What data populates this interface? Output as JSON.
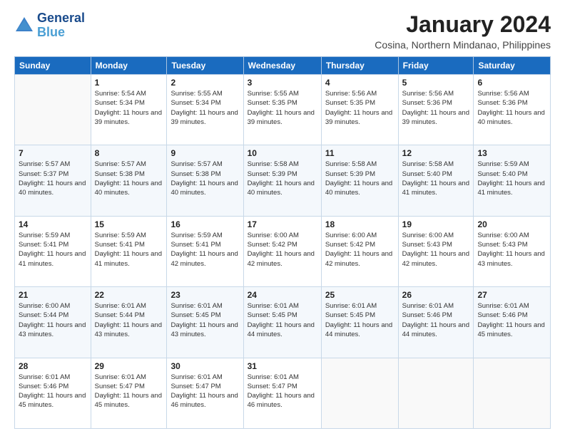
{
  "header": {
    "logo_line1": "General",
    "logo_line2": "Blue",
    "month": "January 2024",
    "location": "Cosina, Northern Mindanao, Philippines"
  },
  "weekdays": [
    "Sunday",
    "Monday",
    "Tuesday",
    "Wednesday",
    "Thursday",
    "Friday",
    "Saturday"
  ],
  "weeks": [
    [
      {
        "day": "",
        "sunrise": "",
        "sunset": "",
        "daylight": ""
      },
      {
        "day": "1",
        "sunrise": "Sunrise: 5:54 AM",
        "sunset": "Sunset: 5:34 PM",
        "daylight": "Daylight: 11 hours and 39 minutes."
      },
      {
        "day": "2",
        "sunrise": "Sunrise: 5:55 AM",
        "sunset": "Sunset: 5:34 PM",
        "daylight": "Daylight: 11 hours and 39 minutes."
      },
      {
        "day": "3",
        "sunrise": "Sunrise: 5:55 AM",
        "sunset": "Sunset: 5:35 PM",
        "daylight": "Daylight: 11 hours and 39 minutes."
      },
      {
        "day": "4",
        "sunrise": "Sunrise: 5:56 AM",
        "sunset": "Sunset: 5:35 PM",
        "daylight": "Daylight: 11 hours and 39 minutes."
      },
      {
        "day": "5",
        "sunrise": "Sunrise: 5:56 AM",
        "sunset": "Sunset: 5:36 PM",
        "daylight": "Daylight: 11 hours and 39 minutes."
      },
      {
        "day": "6",
        "sunrise": "Sunrise: 5:56 AM",
        "sunset": "Sunset: 5:36 PM",
        "daylight": "Daylight: 11 hours and 40 minutes."
      }
    ],
    [
      {
        "day": "7",
        "sunrise": "Sunrise: 5:57 AM",
        "sunset": "Sunset: 5:37 PM",
        "daylight": "Daylight: 11 hours and 40 minutes."
      },
      {
        "day": "8",
        "sunrise": "Sunrise: 5:57 AM",
        "sunset": "Sunset: 5:38 PM",
        "daylight": "Daylight: 11 hours and 40 minutes."
      },
      {
        "day": "9",
        "sunrise": "Sunrise: 5:57 AM",
        "sunset": "Sunset: 5:38 PM",
        "daylight": "Daylight: 11 hours and 40 minutes."
      },
      {
        "day": "10",
        "sunrise": "Sunrise: 5:58 AM",
        "sunset": "Sunset: 5:39 PM",
        "daylight": "Daylight: 11 hours and 40 minutes."
      },
      {
        "day": "11",
        "sunrise": "Sunrise: 5:58 AM",
        "sunset": "Sunset: 5:39 PM",
        "daylight": "Daylight: 11 hours and 40 minutes."
      },
      {
        "day": "12",
        "sunrise": "Sunrise: 5:58 AM",
        "sunset": "Sunset: 5:40 PM",
        "daylight": "Daylight: 11 hours and 41 minutes."
      },
      {
        "day": "13",
        "sunrise": "Sunrise: 5:59 AM",
        "sunset": "Sunset: 5:40 PM",
        "daylight": "Daylight: 11 hours and 41 minutes."
      }
    ],
    [
      {
        "day": "14",
        "sunrise": "Sunrise: 5:59 AM",
        "sunset": "Sunset: 5:41 PM",
        "daylight": "Daylight: 11 hours and 41 minutes."
      },
      {
        "day": "15",
        "sunrise": "Sunrise: 5:59 AM",
        "sunset": "Sunset: 5:41 PM",
        "daylight": "Daylight: 11 hours and 41 minutes."
      },
      {
        "day": "16",
        "sunrise": "Sunrise: 5:59 AM",
        "sunset": "Sunset: 5:41 PM",
        "daylight": "Daylight: 11 hours and 42 minutes."
      },
      {
        "day": "17",
        "sunrise": "Sunrise: 6:00 AM",
        "sunset": "Sunset: 5:42 PM",
        "daylight": "Daylight: 11 hours and 42 minutes."
      },
      {
        "day": "18",
        "sunrise": "Sunrise: 6:00 AM",
        "sunset": "Sunset: 5:42 PM",
        "daylight": "Daylight: 11 hours and 42 minutes."
      },
      {
        "day": "19",
        "sunrise": "Sunrise: 6:00 AM",
        "sunset": "Sunset: 5:43 PM",
        "daylight": "Daylight: 11 hours and 42 minutes."
      },
      {
        "day": "20",
        "sunrise": "Sunrise: 6:00 AM",
        "sunset": "Sunset: 5:43 PM",
        "daylight": "Daylight: 11 hours and 43 minutes."
      }
    ],
    [
      {
        "day": "21",
        "sunrise": "Sunrise: 6:00 AM",
        "sunset": "Sunset: 5:44 PM",
        "daylight": "Daylight: 11 hours and 43 minutes."
      },
      {
        "day": "22",
        "sunrise": "Sunrise: 6:01 AM",
        "sunset": "Sunset: 5:44 PM",
        "daylight": "Daylight: 11 hours and 43 minutes."
      },
      {
        "day": "23",
        "sunrise": "Sunrise: 6:01 AM",
        "sunset": "Sunset: 5:45 PM",
        "daylight": "Daylight: 11 hours and 43 minutes."
      },
      {
        "day": "24",
        "sunrise": "Sunrise: 6:01 AM",
        "sunset": "Sunset: 5:45 PM",
        "daylight": "Daylight: 11 hours and 44 minutes."
      },
      {
        "day": "25",
        "sunrise": "Sunrise: 6:01 AM",
        "sunset": "Sunset: 5:45 PM",
        "daylight": "Daylight: 11 hours and 44 minutes."
      },
      {
        "day": "26",
        "sunrise": "Sunrise: 6:01 AM",
        "sunset": "Sunset: 5:46 PM",
        "daylight": "Daylight: 11 hours and 44 minutes."
      },
      {
        "day": "27",
        "sunrise": "Sunrise: 6:01 AM",
        "sunset": "Sunset: 5:46 PM",
        "daylight": "Daylight: 11 hours and 45 minutes."
      }
    ],
    [
      {
        "day": "28",
        "sunrise": "Sunrise: 6:01 AM",
        "sunset": "Sunset: 5:46 PM",
        "daylight": "Daylight: 11 hours and 45 minutes."
      },
      {
        "day": "29",
        "sunrise": "Sunrise: 6:01 AM",
        "sunset": "Sunset: 5:47 PM",
        "daylight": "Daylight: 11 hours and 45 minutes."
      },
      {
        "day": "30",
        "sunrise": "Sunrise: 6:01 AM",
        "sunset": "Sunset: 5:47 PM",
        "daylight": "Daylight: 11 hours and 46 minutes."
      },
      {
        "day": "31",
        "sunrise": "Sunrise: 6:01 AM",
        "sunset": "Sunset: 5:47 PM",
        "daylight": "Daylight: 11 hours and 46 minutes."
      },
      {
        "day": "",
        "sunrise": "",
        "sunset": "",
        "daylight": ""
      },
      {
        "day": "",
        "sunrise": "",
        "sunset": "",
        "daylight": ""
      },
      {
        "day": "",
        "sunrise": "",
        "sunset": "",
        "daylight": ""
      }
    ]
  ]
}
